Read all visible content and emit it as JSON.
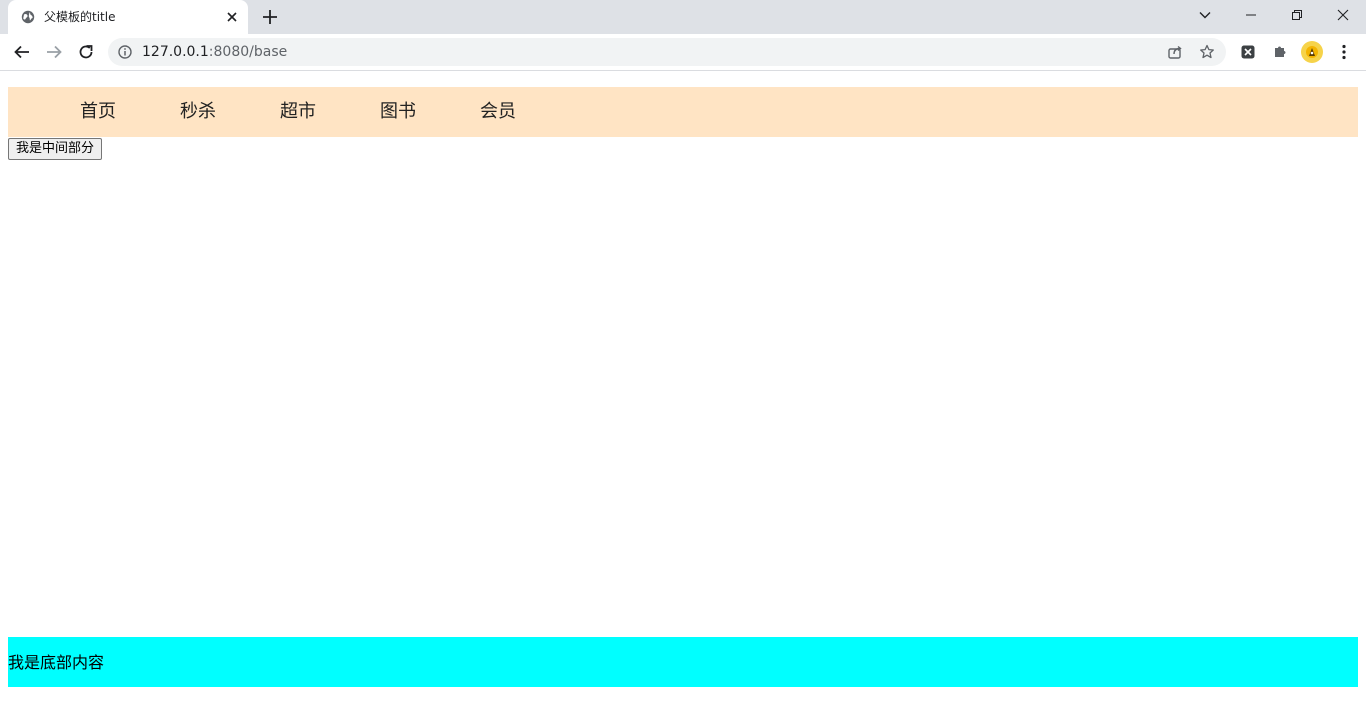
{
  "browser": {
    "tab": {
      "title": "父模板的title"
    },
    "address": {
      "host": "127.0.0.1",
      "rest": ":8080/base"
    }
  },
  "page": {
    "nav": {
      "items": [
        "首页",
        "秒杀",
        "超市",
        "图书",
        "会员"
      ],
      "background": "#ffe4c4"
    },
    "middle_button": "我是中间部分",
    "footer": {
      "text": "我是底部内容",
      "background": "#00ffff"
    }
  }
}
